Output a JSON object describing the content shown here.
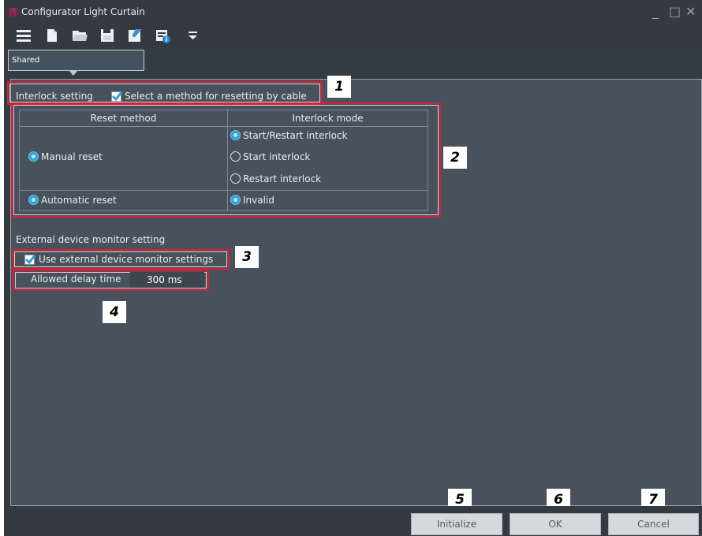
{
  "window": {
    "title": "Configurator Light Curtain",
    "controls": {
      "minimize": "_",
      "maximize": "□",
      "close": "✕"
    }
  },
  "toolbar": {
    "items": [
      {
        "icon": "menu-icon"
      },
      {
        "icon": "new-file-icon"
      },
      {
        "icon": "open-folder-icon"
      },
      {
        "icon": "save-icon"
      },
      {
        "icon": "edit-write-icon"
      },
      {
        "icon": "info-icon"
      },
      {
        "icon": "dropdown-arrow-icon"
      }
    ]
  },
  "tabs": {
    "active": "Shared"
  },
  "interlock": {
    "heading": "Interlock setting",
    "cable_reset_label": "Select a method for resetting by cable",
    "cable_reset_checked": true,
    "table": {
      "col_reset_method": "Reset method",
      "col_interlock_mode": "Interlock mode",
      "manual_reset": "Manual reset",
      "automatic_reset": "Automatic reset",
      "modes": [
        "Start/Restart interlock",
        "Start interlock",
        "Restart interlock"
      ],
      "invalid": "Invalid",
      "selected_reset": "Manual reset",
      "selected_mode": "Start/Restart interlock"
    }
  },
  "external": {
    "heading": "External device monitor setting",
    "use_label": "Use external device monitor settings",
    "use_checked": true,
    "delay_label": "Allowed delay time",
    "delay_value": "300 ms"
  },
  "buttons": {
    "initialize": "Initialize",
    "ok": "OK",
    "cancel": "Cancel"
  },
  "callouts": [
    "1",
    "2",
    "3",
    "4",
    "5",
    "6",
    "7"
  ],
  "colors": {
    "window_bg": "#333a40",
    "panel_bg": "#47525c",
    "accent": "#2fa2d3",
    "highlight": "#d0203a"
  }
}
